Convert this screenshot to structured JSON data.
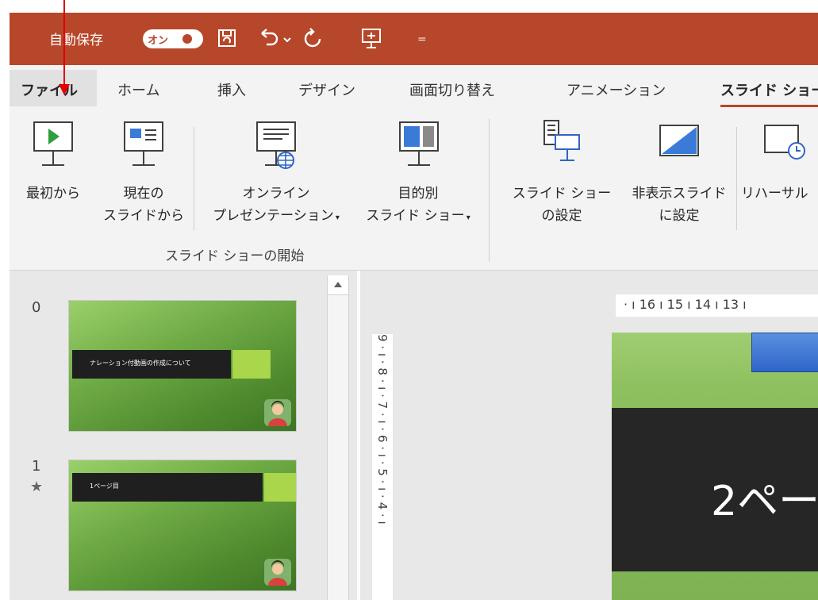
{
  "titlebar": {
    "autosave_label": "自動保存",
    "toggle_text": "オン",
    "qa_icons": [
      "save-icon",
      "undo-icon",
      "dropdown-icon",
      "redo-icon",
      "present-icon",
      "customize-icon"
    ],
    "customize_glyph": "₌"
  },
  "tabs": [
    {
      "label": "ファイル",
      "active": true
    },
    {
      "label": "ホーム"
    },
    {
      "label": "挿入"
    },
    {
      "label": "デザイン"
    },
    {
      "label": "画面切り替え"
    },
    {
      "label": "アニメーション"
    },
    {
      "label": "スライド ショー"
    }
  ],
  "ribbon": {
    "buttons": [
      {
        "line1": "最初から",
        "line2": "",
        "icon": "play-from-start-icon"
      },
      {
        "line1": "現在の",
        "line2": "スライドから",
        "icon": "from-current-icon"
      },
      {
        "line1": "オンライン",
        "line2": "プレゼンテーション",
        "caret": true,
        "icon": "online-presentation-icon"
      },
      {
        "line1": "目的別",
        "line2": "スライド ショー",
        "caret": true,
        "icon": "custom-show-icon"
      },
      {
        "line1": "スライド ショー",
        "line2": "の設定",
        "icon": "setup-show-icon"
      },
      {
        "line1": "非表示スライド",
        "line2": "に設定",
        "icon": "hide-slide-icon"
      },
      {
        "line1": "リハーサル",
        "line2": "",
        "icon": "rehearse-timings-icon"
      }
    ],
    "group_label": "スライド ショーの開始",
    "caret_glyph": "▾"
  },
  "thumbnails": [
    {
      "number": "0",
      "text": "ナレーション付動画の作成について",
      "star": ""
    },
    {
      "number": "1",
      "text": "1ページ目",
      "star": "★"
    }
  ],
  "ruler": {
    "horizontal": "· ı 16 ı 15 ı 14 ı 13 ı",
    "vertical": "9 · ı · 8 · ı · 7 · ı · 6 · ı · 5 · ı · 4 · ı"
  },
  "slide": {
    "title_text": "2ペー"
  },
  "colors": {
    "accent": "#b7472a",
    "pointer": "#e00000"
  }
}
